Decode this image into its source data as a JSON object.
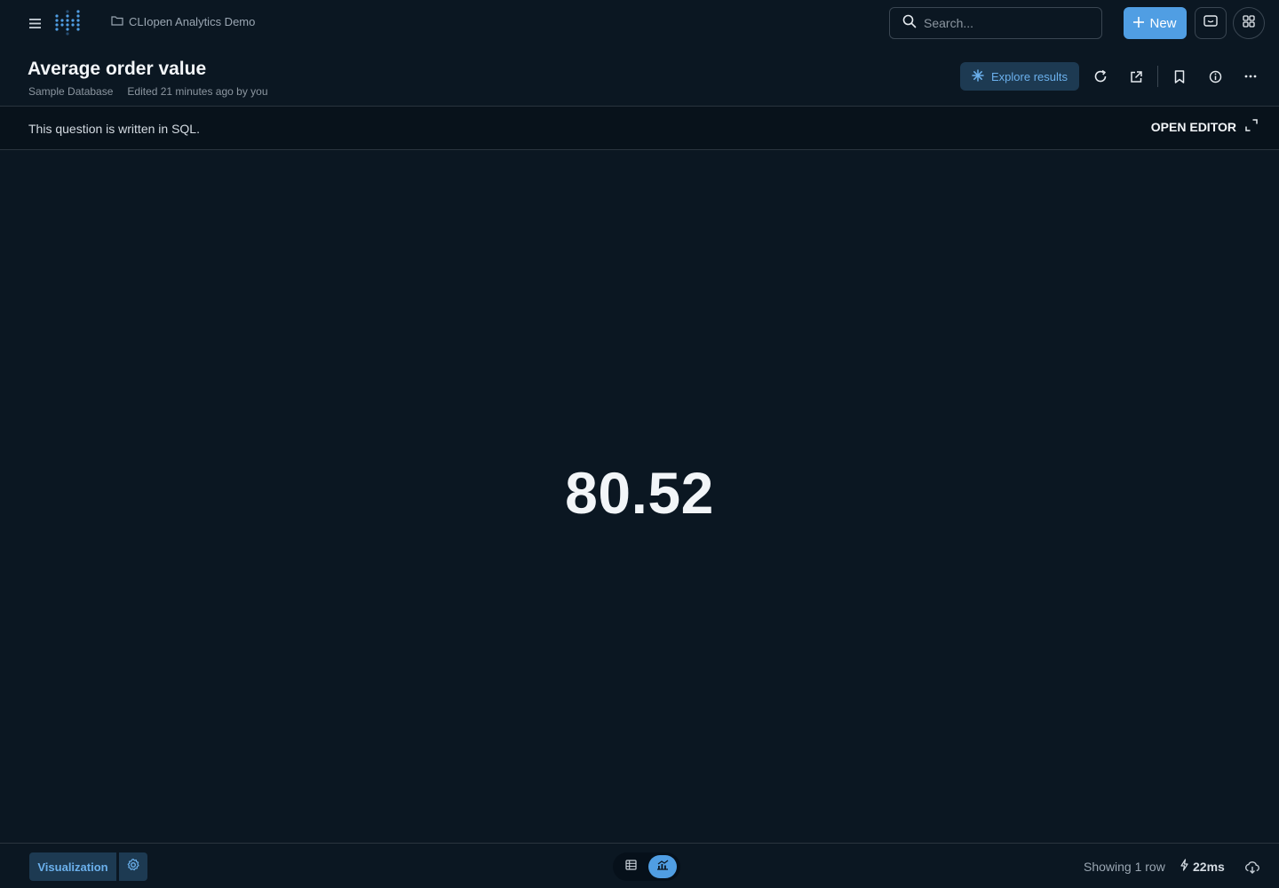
{
  "nav": {
    "collection": "CLIopen Analytics Demo",
    "search_placeholder": "Search...",
    "new_label": "New"
  },
  "question": {
    "title": "Average order value",
    "database": "Sample Database",
    "edited": "Edited 21 minutes ago by you",
    "explore_label": "Explore results"
  },
  "notice": {
    "text": "This question is written in SQL.",
    "open_editor": "OPEN EDITOR"
  },
  "result": {
    "value": "80.52"
  },
  "footer": {
    "visualization_label": "Visualization",
    "showing": "Showing 1 row",
    "timing": "22ms"
  },
  "colors": {
    "background": "#0b1722",
    "accent": "#509ee3",
    "accent_muted": "#1d3a52"
  },
  "icons": [
    "hamburger-icon",
    "logo-icon",
    "folder-icon",
    "search-icon",
    "plus-icon",
    "chat-icon",
    "grid-icon",
    "sparkle-icon",
    "refresh-icon",
    "share-icon",
    "bookmark-icon",
    "info-icon",
    "more-icon",
    "expand-icon",
    "gear-icon",
    "table-icon",
    "chart-icon",
    "bolt-icon",
    "download-icon"
  ]
}
